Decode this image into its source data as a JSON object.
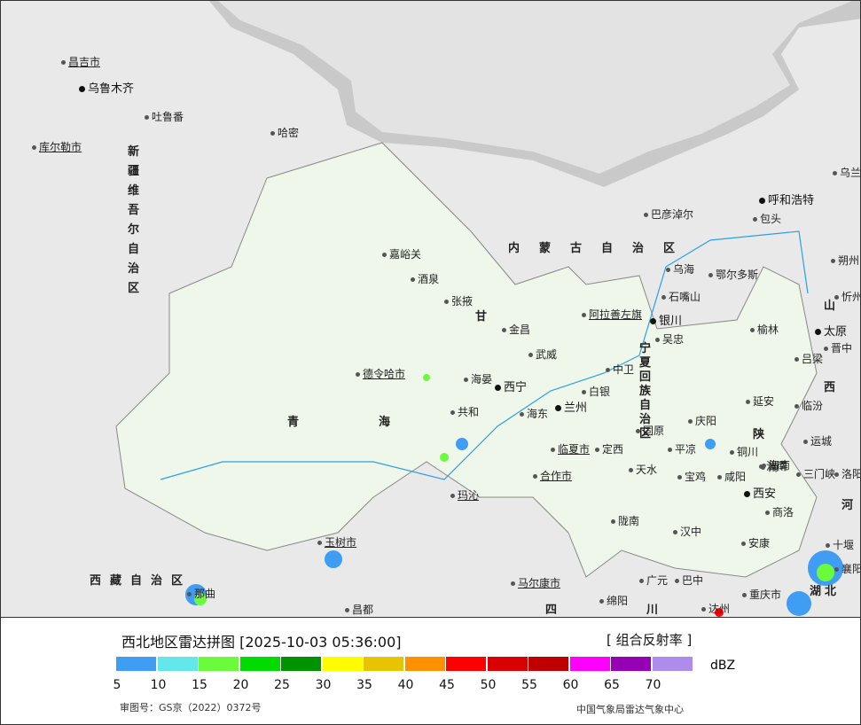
{
  "map": {
    "provinces": [
      "新疆维吾尔自治区",
      "内蒙古自治区",
      "青海",
      "甘",
      "西藏自治区",
      "宁夏回族自治区",
      "陕",
      "山",
      "西",
      "河",
      "湖北",
      "四",
      "川"
    ],
    "cities": [
      "昌吉市",
      "乌鲁木齐",
      "吐鲁番",
      "哈密",
      "库尔勒市",
      "嘉峪关",
      "酒泉",
      "张掖",
      "金昌",
      "武威",
      "德令哈市",
      "海晏",
      "西宁",
      "海东",
      "共和",
      "兰州",
      "白银",
      "中卫",
      "吴忠",
      "银川",
      "石嘴山",
      "乌海",
      "阿拉善左旗",
      "巴彦淖尔",
      "包头",
      "呼和浩特",
      "鄂尔多斯",
      "乌兰察布",
      "榆林",
      "延安",
      "庆阳",
      "固原",
      "平凉",
      "定西",
      "临夏市",
      "合作市",
      "天水",
      "宝鸡",
      "咸阳",
      "西安",
      "铜川",
      "渭南",
      "商洛",
      "汉中",
      "安康",
      "陇南",
      "玛沁",
      "玉树市",
      "那曲",
      "昌都",
      "马尔康市",
      "绵阳",
      "广元",
      "巴中",
      "达州",
      "重庆市",
      "太原",
      "吕梁",
      "临汾",
      "运城",
      "三门峡",
      "洛阳",
      "忻州",
      "朔州",
      "晋中",
      "十堰",
      "襄阳",
      "海南",
      "南"
    ]
  },
  "legend": {
    "title": "西北地区雷达拼图 [2025-10-03 05:36:00]",
    "product": "[ 组合反射率 ]",
    "unit": "dBZ",
    "colors": [
      "#3f9ef3",
      "#63e7eb",
      "#6cfb3c",
      "#00dc00",
      "#009300",
      "#fffc00",
      "#e8c300",
      "#ff9100",
      "#ff0000",
      "#d80000",
      "#be0000",
      "#ff00ff",
      "#9600b4",
      "#ae8ceb"
    ],
    "ticks": [
      "5",
      "10",
      "15",
      "20",
      "25",
      "30",
      "35",
      "40",
      "45",
      "50",
      "55",
      "60",
      "65",
      "70"
    ],
    "approval": "审图号：GS京（2022）0372号",
    "agency": "中国气象局雷达气象中心"
  }
}
